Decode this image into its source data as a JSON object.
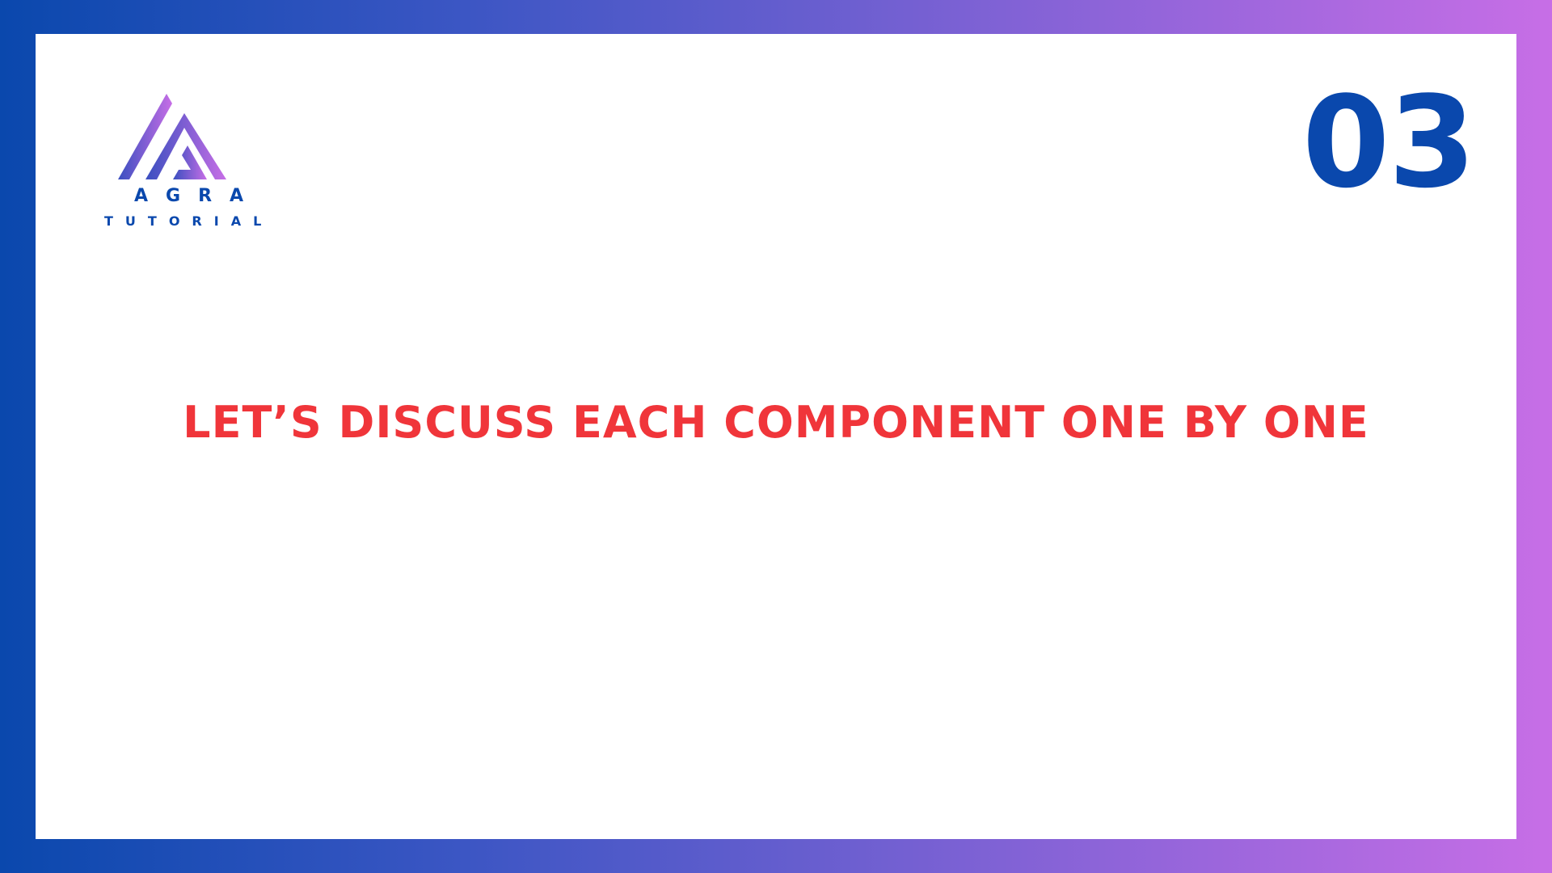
{
  "logo": {
    "icon": "agra-tutorial-triangle-logo",
    "line1": "AGRA",
    "line2": "TUTORIAL"
  },
  "slide": {
    "number": "03",
    "headline": "LET’S DISCUSS EACH COMPONENT ONE BY ONE"
  },
  "colors": {
    "brand_blue": "#0a48ad",
    "brand_purple": "#c76ee6",
    "headline_red": "#f0353a",
    "background": "#ffffff"
  }
}
